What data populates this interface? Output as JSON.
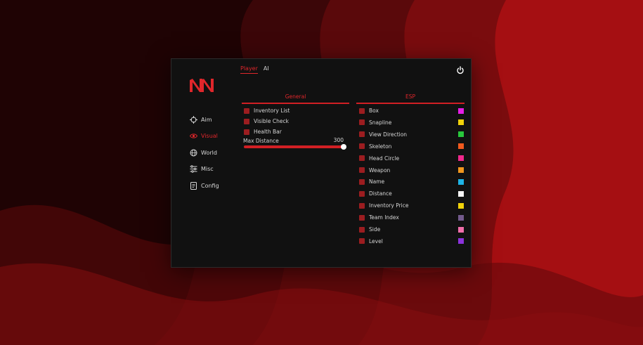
{
  "tabs": [
    {
      "label": "Player",
      "active": true
    },
    {
      "label": "AI",
      "active": false
    }
  ],
  "nav": [
    {
      "label": "Aim",
      "icon": "crosshair-icon",
      "active": false
    },
    {
      "label": "Visual",
      "icon": "eye-icon",
      "active": true
    },
    {
      "label": "World",
      "icon": "globe-icon",
      "active": false
    },
    {
      "label": "Misc",
      "icon": "sliders-icon",
      "active": false
    },
    {
      "label": "Config",
      "icon": "document-icon",
      "active": false
    }
  ],
  "general": {
    "title": "General",
    "options": [
      "Inventory List",
      "Visible Check",
      "Health Bar"
    ],
    "slider": {
      "label": "Max Distance",
      "value": "300",
      "fraction": 1.0
    }
  },
  "esp": {
    "title": "ESP",
    "options": [
      {
        "label": "Box",
        "color": "#e61ee6"
      },
      {
        "label": "Snapline",
        "color": "#f0d20a"
      },
      {
        "label": "View Direction",
        "color": "#28c83c"
      },
      {
        "label": "Skeleton",
        "color": "#f05a1e"
      },
      {
        "label": "Head Circle",
        "color": "#f0288c"
      },
      {
        "label": "Weapon",
        "color": "#f0961e"
      },
      {
        "label": "Name",
        "color": "#1eb4e6"
      },
      {
        "label": "Distance",
        "color": "#f5f5f5"
      },
      {
        "label": "Inventory Price",
        "color": "#f0d20a"
      },
      {
        "label": "Team Index",
        "color": "#735a8c"
      },
      {
        "label": "Side",
        "color": "#f06eaa"
      },
      {
        "label": "Level",
        "color": "#8c32dc"
      }
    ]
  },
  "colors": {
    "accent": "#e0262b",
    "panel": "#111111",
    "checkbox": "#9c1d20"
  },
  "icons": {
    "logo": "nn-logo",
    "power": "power-icon"
  }
}
